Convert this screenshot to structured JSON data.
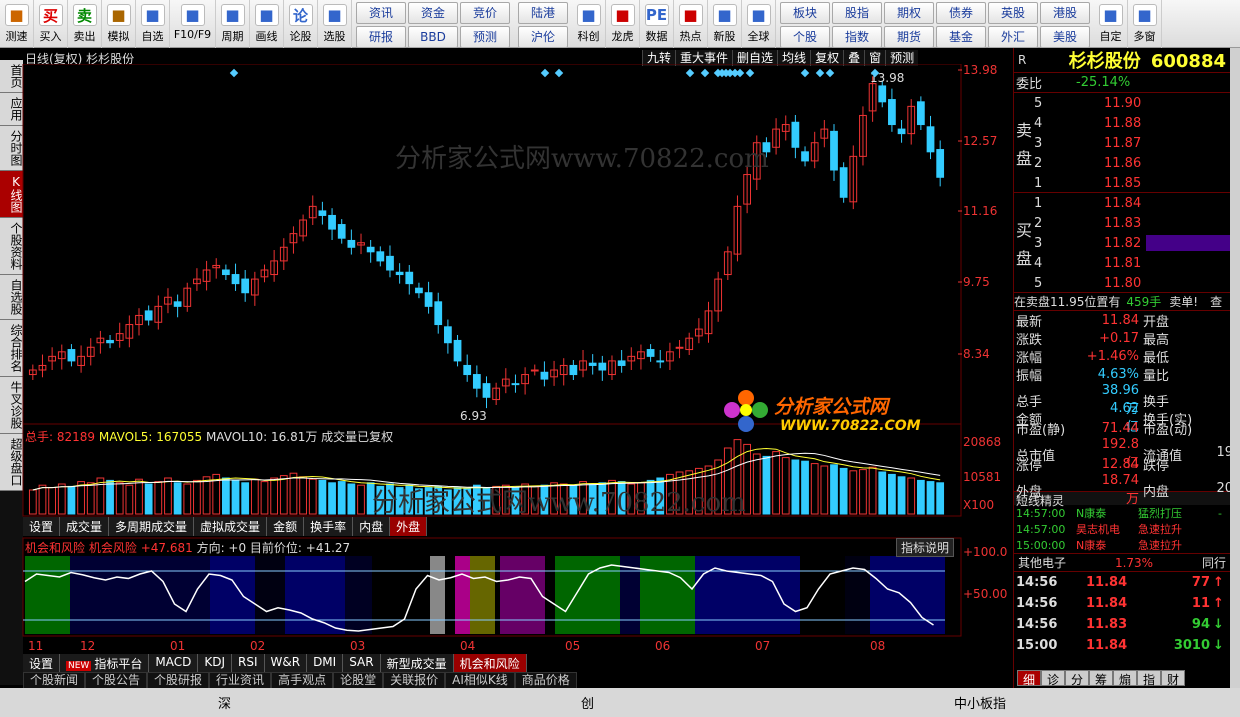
{
  "toolbar": {
    "buttons": [
      {
        "label": "测速",
        "icon": "clock-icon"
      },
      {
        "label": "买入",
        "icon": "buy-icon",
        "glyph": "买"
      },
      {
        "label": "卖出",
        "icon": "sell-icon",
        "glyph": "卖"
      },
      {
        "label": "模拟",
        "icon": "hammer-icon"
      },
      {
        "label": "自选",
        "icon": "star-icon"
      },
      {
        "label": "F10/F9",
        "icon": "f10-icon"
      },
      {
        "label": "周期",
        "icon": "period-icon"
      },
      {
        "label": "画线",
        "icon": "pen-icon"
      },
      {
        "label": "论股",
        "icon": "discuss-icon",
        "glyph": "论"
      },
      {
        "label": "选股",
        "icon": "select-stock-icon"
      }
    ],
    "grid1": [
      "资讯",
      "资金",
      "竞价",
      "研报",
      "BBD",
      "预测"
    ],
    "grid2": [
      "陆港",
      "沪伦"
    ],
    "buttons2": [
      {
        "label": "科创",
        "icon": "star-market-icon"
      },
      {
        "label": "龙虎",
        "icon": "dragon-tiger-icon"
      },
      {
        "label": "数据",
        "icon": "pe-data-icon",
        "glyph": "PE"
      },
      {
        "label": "热点",
        "icon": "hot-icon"
      },
      {
        "label": "新股",
        "icon": "new-stock-icon"
      },
      {
        "label": "全球",
        "icon": "globe-icon"
      }
    ],
    "grid3": [
      "板块",
      "股指",
      "期权",
      "债券",
      "英股",
      "港股",
      "个股",
      "指数",
      "期货",
      "基金",
      "外汇",
      "美股"
    ],
    "buttons3": [
      {
        "label": "自定",
        "icon": "custom-icon"
      },
      {
        "label": "多窗",
        "icon": "multi-window-icon"
      }
    ]
  },
  "sidebar": [
    "首页",
    "应用",
    "分时图",
    "K线图",
    "个股资料",
    "自选股",
    "综合排名",
    "牛叉诊股",
    "超级盘口"
  ],
  "chart_header": {
    "title": "日线(复权) 杉杉股份",
    "buttons": [
      "九转",
      "重大事件",
      "删自选",
      "均线",
      "复权",
      "叠",
      "窗",
      "预测"
    ]
  },
  "price_axis": [
    "13.98",
    "12.57",
    "11.16",
    "9.75",
    "8.34"
  ],
  "price_annotations": {
    "high": "13.98",
    "low": "6.93"
  },
  "volume_header": {
    "total": "总手: 82189",
    "mavol5": "MAVOL5: 167055",
    "mavol10": "MAVOL10: 16.81万",
    "note": "成交量已复权"
  },
  "volume_axis": [
    "20868",
    "10581",
    "X100"
  ],
  "volume_tabs": [
    "设置",
    "成交量",
    "多周期成交量",
    "虚拟成交量",
    "金额",
    "换手率",
    "内盘",
    "外盘"
  ],
  "indicator_header": {
    "name": "机会和风险",
    "sub": "机会风险",
    "value": "+47.681",
    "direction": "方向: +0 目前价位: +41.27",
    "help": "指标说明"
  },
  "indicator_axis": [
    "+100.0",
    "+50.00"
  ],
  "months": [
    "11",
    "12",
    "01",
    "02",
    "03",
    "04",
    "05",
    "06",
    "07",
    "08"
  ],
  "indicator_tabs": [
    "设置",
    "指标平台",
    "MACD",
    "KDJ",
    "RSI",
    "W&R",
    "DMI",
    "SAR",
    "新型成交量",
    "机会和风险"
  ],
  "new_badge": "NEW",
  "news_tabs": [
    "个股新闻",
    "个股公告",
    "个股研报",
    "行业资讯",
    "高手观点",
    "论股堂",
    "关联报价",
    "AI相似K线",
    "商品价格"
  ],
  "status": {
    "left": "深",
    "mid": "创",
    "right": "中小板指"
  },
  "watermark": "分析家公式网www.70822.com",
  "logo": {
    "title": "分析家公式网",
    "url": "WWW.70822.COM"
  },
  "stock": {
    "code_label": "R",
    "name": "杉杉股份",
    "code": "600884"
  },
  "weibi": {
    "label": "委比",
    "value": "-25.14%"
  },
  "sell_orders": [
    {
      "level": "5",
      "price": "11.90"
    },
    {
      "level": "4",
      "price": "11.88"
    },
    {
      "level": "3",
      "price": "11.87"
    },
    {
      "level": "2",
      "price": "11.86"
    },
    {
      "level": "1",
      "price": "11.85"
    }
  ],
  "buy_orders": [
    {
      "level": "1",
      "price": "11.84"
    },
    {
      "level": "2",
      "price": "11.83"
    },
    {
      "level": "3",
      "price": "11.82"
    },
    {
      "level": "4",
      "price": "11.81"
    },
    {
      "level": "5",
      "price": "11.80"
    }
  ],
  "sell_label": [
    "卖",
    "盘"
  ],
  "buy_label": [
    "买",
    "盘"
  ],
  "order_note": {
    "text": "在卖盘11.95位置有",
    "qty": "459手",
    "tag": "卖单!",
    "tail": "查"
  },
  "quotes": [
    {
      "k1": "最新",
      "v1": "11.84",
      "k2": "开盘"
    },
    {
      "k1": "涨跌",
      "v1": "+0.17",
      "k2": "最高"
    },
    {
      "k1": "涨幅",
      "v1": "+1.46%",
      "k2": "最低"
    },
    {
      "k1": "振幅",
      "v1": "4.63%",
      "k2": "量比"
    },
    {
      "k1": "总手",
      "v1": "38.96万",
      "k2": "换手"
    },
    {
      "k1": "金额",
      "v1": "4.62亿",
      "k2": "换手(实)"
    },
    {
      "k1": "市盈(静)",
      "v1": "71.44",
      "k2": "市盈(动)"
    },
    {
      "k1": "总市值",
      "v1": "192.8亿",
      "k2": "流通值",
      "v2": "19"
    },
    {
      "k1": "涨停",
      "v1": "12.84",
      "k2": "跌停"
    },
    {
      "k1": "外盘",
      "v1": "18.74万",
      "k2": "内盘",
      "v2": "20"
    }
  ],
  "short_spirit": {
    "title": "短线精灵",
    "items": [
      {
        "time": "14:57:00",
        "name": "N康泰",
        "event": "猛烈打压",
        "extra": "-"
      },
      {
        "time": "14:57:00",
        "name": "昊志机电",
        "event": "急速拉升",
        "extra": ""
      },
      {
        "time": "15:00:00",
        "name": "N康泰",
        "event": "急速拉升",
        "extra": ""
      }
    ]
  },
  "sector": {
    "name": "其他电子",
    "pct": "1.73%",
    "more": "同行"
  },
  "ticks": [
    {
      "time": "14:56",
      "price": "11.84",
      "vol": "77",
      "dir": "up"
    },
    {
      "time": "14:56",
      "price": "11.84",
      "vol": "11",
      "dir": "up"
    },
    {
      "time": "14:56",
      "price": "11.83",
      "vol": "94",
      "dir": "down"
    },
    {
      "time": "15:00",
      "price": "11.84",
      "vol": "3010",
      "dir": "down"
    }
  ],
  "bottom_tabs": [
    "细",
    "诊",
    "分",
    "筹",
    "煽",
    "指",
    "财"
  ],
  "chart_data": {
    "type": "candlestick",
    "y_range": [
      6.5,
      14.2
    ],
    "series_close": [
      7.6,
      7.7,
      7.9,
      8.0,
      7.8,
      7.9,
      8.1,
      8.3,
      8.2,
      8.4,
      8.6,
      8.8,
      8.7,
      9.0,
      9.2,
      9.0,
      9.4,
      9.6,
      9.8,
      9.9,
      9.7,
      9.5,
      9.3,
      9.6,
      9.8,
      10.0,
      10.3,
      10.6,
      10.9,
      11.2,
      11.0,
      10.7,
      10.5,
      10.3,
      10.4,
      10.2,
      10.0,
      9.8,
      9.7,
      9.5,
      9.3,
      9.0,
      8.6,
      8.2,
      7.8,
      7.5,
      7.2,
      7.0,
      7.2,
      7.4,
      7.3,
      7.5,
      7.6,
      7.4,
      7.6,
      7.7,
      7.5,
      7.8,
      7.7,
      7.6,
      7.8,
      7.7,
      7.9,
      8.0,
      7.9,
      7.8,
      8.0,
      8.1,
      8.3,
      8.5,
      8.9,
      9.6,
      10.2,
      11.2,
      11.9,
      12.6,
      12.4,
      12.9,
      13.0,
      12.5,
      12.2,
      12.6,
      12.9,
      12.0,
      11.4,
      12.3,
      13.2,
      13.9,
      13.5,
      13.0,
      12.8,
      13.4,
      13.0,
      12.4,
      11.84
    ],
    "volume": [
      20,
      24,
      22,
      25,
      23,
      27,
      26,
      30,
      28,
      26,
      24,
      29,
      25,
      27,
      30,
      26,
      25,
      28,
      31,
      33,
      30,
      28,
      26,
      29,
      27,
      30,
      32,
      34,
      31,
      29,
      28,
      26,
      27,
      25,
      24,
      26,
      23,
      25,
      22,
      24,
      21,
      22,
      23,
      20,
      22,
      21,
      24,
      22,
      23,
      24,
      22,
      25,
      23,
      24,
      26,
      25,
      24,
      27,
      25,
      26,
      28,
      27,
      25,
      26,
      28,
      30,
      33,
      35,
      36,
      38,
      40,
      45,
      55,
      62,
      58,
      50,
      48,
      52,
      47,
      45,
      44,
      42,
      40,
      41,
      38,
      36,
      37,
      39,
      35,
      33,
      31,
      30,
      28,
      27,
      26
    ],
    "indicator_line": [
      70,
      80,
      78,
      76,
      82,
      79,
      75,
      72,
      76,
      74,
      80,
      84,
      70,
      40,
      30,
      60,
      80,
      78,
      72,
      50,
      40,
      30,
      35,
      32,
      28,
      20,
      15,
      8,
      5,
      4,
      6,
      8,
      10,
      20,
      60,
      78,
      72,
      75,
      80,
      74,
      76,
      70,
      72,
      76,
      74,
      50,
      40,
      30,
      55,
      80,
      88,
      92,
      90,
      88,
      86,
      84,
      82,
      75,
      60,
      80,
      88,
      84,
      82,
      80,
      78,
      70,
      40,
      30,
      35,
      60,
      80,
      84,
      88,
      86,
      74,
      60,
      55,
      42,
      22,
      12
    ]
  }
}
